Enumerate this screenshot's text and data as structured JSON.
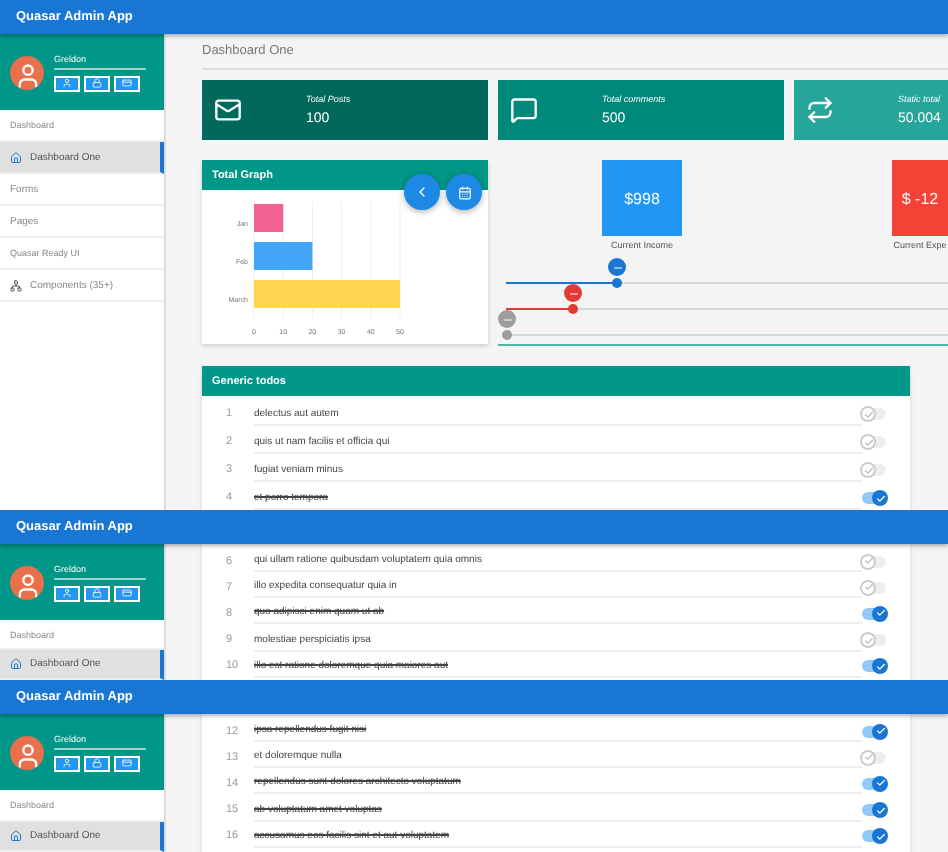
{
  "frames": [
    {
      "kind": "full",
      "app_title": "Quasar Admin App",
      "user": {
        "name": "Greldon"
      },
      "sidebar": [
        {
          "kind": "section",
          "label": "Dashboard",
          "selected": false
        },
        {
          "kind": "page",
          "label": "Dashboard One",
          "selected": true
        },
        {
          "kind": "link",
          "label": "Forms",
          "selected": false
        },
        {
          "kind": "link",
          "label": "Pages",
          "selected": false
        },
        {
          "kind": "section",
          "label": "Quasar Ready UI",
          "selected": false
        },
        {
          "kind": "group",
          "label": "Components (35+)",
          "selected": false
        }
      ],
      "page_title": "Dashboard One",
      "stats": [
        {
          "label": "Total Posts",
          "value": "100",
          "color": "#00695c"
        },
        {
          "label": "Total comments",
          "value": "500",
          "color": "#00897b"
        },
        {
          "label": "Static total",
          "value": "50.004",
          "color": "#26a69a"
        }
      ],
      "graph": {
        "title": "Total Graph",
        "chart_data": {
          "type": "bar",
          "orientation": "horizontal",
          "categories": [
            "Jan",
            "Feb",
            "March"
          ],
          "values": [
            10,
            20,
            50
          ],
          "xlim": [
            0,
            50
          ],
          "xticks": [
            0,
            10,
            20,
            30,
            40,
            50
          ],
          "grid": true
        }
      },
      "gauges": [
        {
          "value": "$998",
          "label": "Current Income",
          "color": "#2196f3"
        },
        {
          "value": "$ -12",
          "label": "Current Expe",
          "color": "#f44336"
        }
      ],
      "sliders": [
        {
          "level": 0.25,
          "color": "#1976d2"
        },
        {
          "level": 0.15,
          "color": "#e53935"
        },
        {
          "level": 0,
          "color": "#9e9e9e"
        }
      ],
      "todo_title": "Generic todos",
      "todos": [
        {
          "number": "1",
          "text": "delectus aut autem",
          "done": false
        },
        {
          "number": "2",
          "text": "quis ut nam facilis et officia qui",
          "done": false
        },
        {
          "number": "3",
          "text": "fugiat veniam minus",
          "done": false
        },
        {
          "number": "4",
          "text": "et porro tempora",
          "done": true
        }
      ]
    },
    {
      "kind": "partial",
      "app_title": "Quasar Admin App",
      "user": {
        "name": "Greldon"
      },
      "sidebar": [
        {
          "kind": "section",
          "label": "Dashboard",
          "selected": false
        },
        {
          "kind": "page",
          "label": "Dashboard One",
          "selected": true
        }
      ],
      "todos": [
        {
          "number": "6",
          "text": "qui ullam ratione quibusdam voluptatem quia omnis",
          "done": false
        },
        {
          "number": "7",
          "text": "illo expedita consequatur quia in",
          "done": false
        },
        {
          "number": "8",
          "text": "quo adipisci enim quam ut ab",
          "done": true
        },
        {
          "number": "9",
          "text": "molestiae perspiciatis ipsa",
          "done": false
        },
        {
          "number": "10",
          "text": "illo est ratione doloremque quia maiores aut",
          "done": true
        }
      ]
    },
    {
      "kind": "partial",
      "app_title": "Quasar Admin App",
      "user": {
        "name": "Greldon"
      },
      "sidebar": [
        {
          "kind": "section",
          "label": "Dashboard",
          "selected": false
        },
        {
          "kind": "page",
          "label": "Dashboard One",
          "selected": true
        }
      ],
      "todos": [
        {
          "number": "12",
          "text": "ipsa repellendus fugit nisi",
          "done": true
        },
        {
          "number": "13",
          "text": "et doloremque nulla",
          "done": false
        },
        {
          "number": "14",
          "text": "repellendus sunt dolores architecto voluptatum",
          "done": true
        },
        {
          "number": "15",
          "text": "ab voluptatum amet voluptas",
          "done": true
        },
        {
          "number": "16",
          "text": "accusamus eos facilis sint et aut voluptatem",
          "done": true
        }
      ]
    }
  ]
}
